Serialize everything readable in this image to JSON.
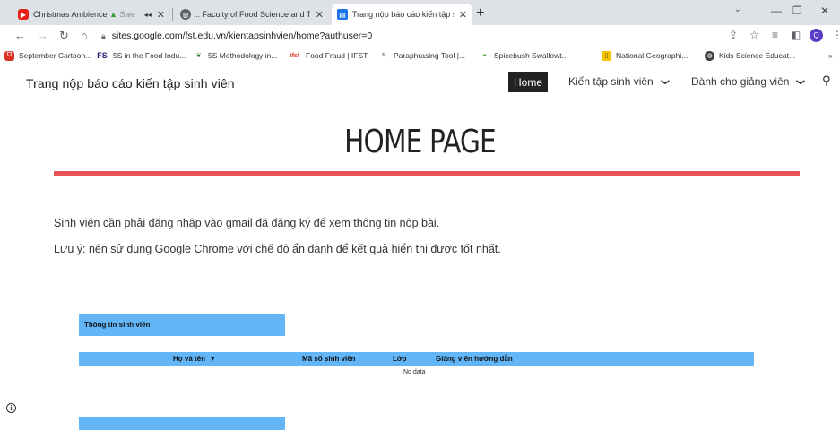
{
  "browser": {
    "tabs": [
      {
        "title": "Christmas Ambience",
        "title_extra": "Swe",
        "icon": "youtube-icon"
      },
      {
        "title": ".: Faculty of Food Science and Te",
        "icon": "globe-icon"
      },
      {
        "title": "Trang nộp báo cáo kiến tập sinh",
        "icon": "google-sites-icon"
      }
    ],
    "url": "sites.google.com/fst.edu.vn/kientapsinhvien/home?authuser=0",
    "profile_initial": "Q",
    "bookmarks": [
      {
        "label": "September Cartoon...",
        "icon": "shield-icon"
      },
      {
        "label": "5S in the Food Indu...",
        "icon": "fs-icon",
        "icon_text": "FS"
      },
      {
        "label": "5S Methodology in...",
        "icon": "leaf-icon"
      },
      {
        "label": "Food Fraud | IFST",
        "icon": "ifst-icon",
        "icon_text": "ifst"
      },
      {
        "label": "Paraphrasing Tool |...",
        "icon": "quill-icon"
      },
      {
        "label": "Spicebush Swallowt...",
        "icon": "butterfly-icon"
      },
      {
        "label": "National Geographi...",
        "icon": "natgeo-icon"
      },
      {
        "label": "Kids Science Educat...",
        "icon": "globe-icon"
      }
    ],
    "bookmarks_overflow": "»"
  },
  "site": {
    "title": "Trang nộp báo cáo kiến tập sinh viên",
    "nav": {
      "home": "Home",
      "student": "Kiến tập sinh viên",
      "lecturer": "Dành cho giảng viên"
    }
  },
  "main": {
    "heading": "HOME PAGE",
    "line1": "Sinh viên cần phải đăng nhập vào gmail đã đăng ký để xem thông tin nộp bài.",
    "line2": "Lưu ý: nên sử dụng Google Chrome với chế độ ẩn danh để kết quả hiển thị được tốt nhất."
  },
  "report": {
    "panel_title": "Thông tin sinh viên",
    "columns": [
      "Họ và tên",
      "Mã số sinh viên",
      "Lớp",
      "Giảng viên hướng dẫn"
    ],
    "sort_indicator": "▾",
    "empty_text": "No data"
  },
  "colors": {
    "accent_red": "#ea5357",
    "table_blue": "#62b6f8",
    "nav_active_bg": "#222222"
  }
}
